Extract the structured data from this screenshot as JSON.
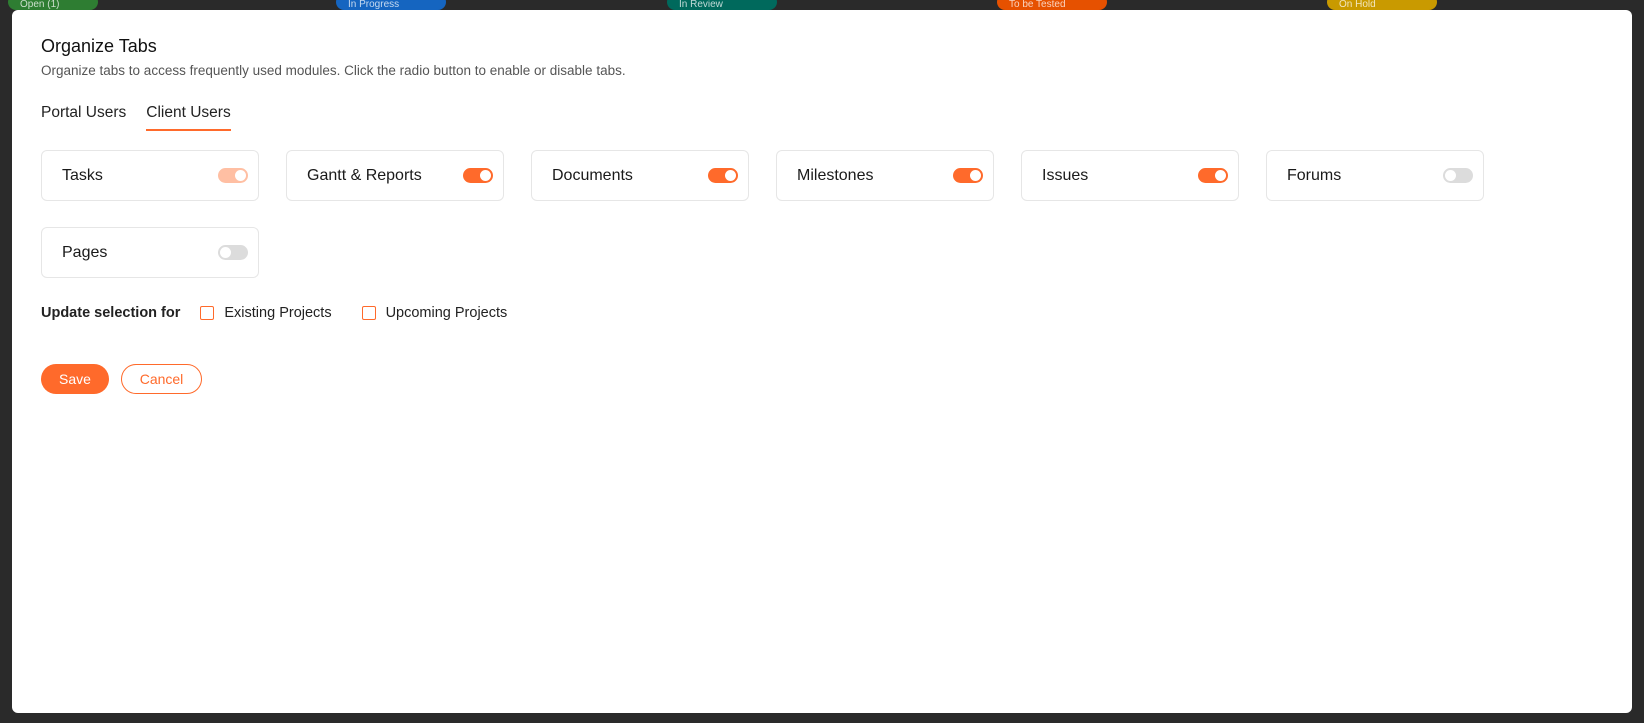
{
  "background_columns": [
    {
      "label": "Open (1)",
      "color": "#2e7d32"
    },
    {
      "label": "In Progress",
      "color": "#1565c0"
    },
    {
      "label": "In Review",
      "color": "#00695c"
    },
    {
      "label": "To be Tested",
      "color": "#e65100"
    },
    {
      "label": "On Hold",
      "color": "#c99a00"
    }
  ],
  "dialog": {
    "title": "Organize Tabs",
    "subtitle": "Organize tabs to access frequently used modules. Click the radio button to enable or disable tabs.",
    "tabs": [
      {
        "label": "Portal Users",
        "active": false
      },
      {
        "label": "Client Users",
        "active": true
      }
    ],
    "modules": [
      {
        "label": "Tasks",
        "state": "on-disabled"
      },
      {
        "label": "Gantt & Reports",
        "state": "on"
      },
      {
        "label": "Documents",
        "state": "on"
      },
      {
        "label": "Milestones",
        "state": "on"
      },
      {
        "label": "Issues",
        "state": "on"
      },
      {
        "label": "Forums",
        "state": "off"
      },
      {
        "label": "Pages",
        "state": "off"
      }
    ],
    "update_label": "Update selection for",
    "checkboxes": [
      {
        "label": "Existing Projects",
        "checked": false
      },
      {
        "label": "Upcoming Projects",
        "checked": false
      }
    ],
    "save_label": "Save",
    "cancel_label": "Cancel",
    "accent": "#ff6a2b"
  }
}
